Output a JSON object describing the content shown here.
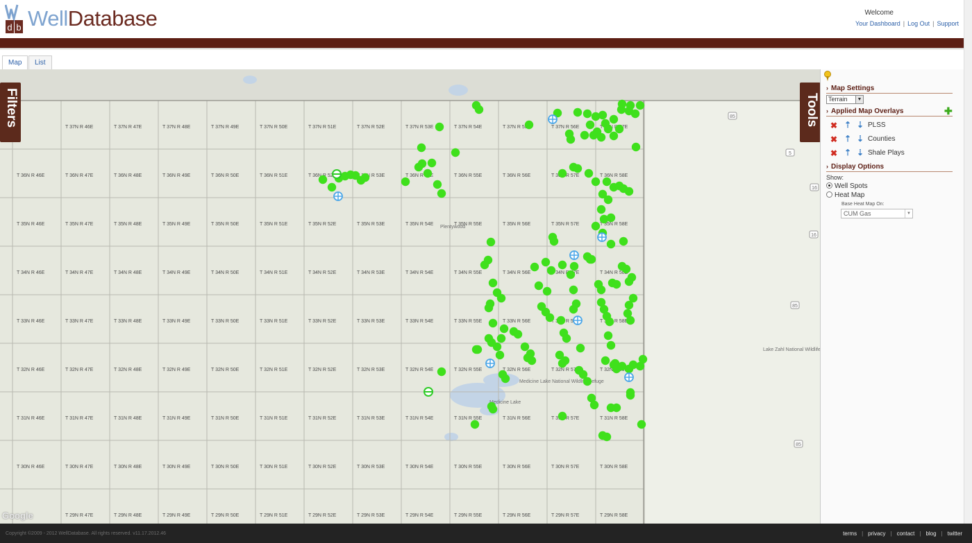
{
  "header": {
    "logo_mark": "wdb",
    "logo_well": "Well",
    "logo_database": "Database",
    "welcome": "Welcome",
    "links": [
      "Your Dashboard",
      "Log Out",
      "Support"
    ]
  },
  "tabs": [
    {
      "label": "Map",
      "active": true
    },
    {
      "label": "List",
      "active": false
    }
  ],
  "side_tabs": {
    "filters": "Filters",
    "tools": "Tools"
  },
  "map": {
    "township_rows": [
      {
        "row": "37N",
        "labels": [
          "T 37N R 46E",
          "T 37N R 47E",
          "T 37N R 48E",
          "T 37N R 49E",
          "T 37N R 50E",
          "T 37N R 51E",
          "T 37N R 52E",
          "T 37N R 53E",
          "T 37N R 54E",
          "T 37N R 55E",
          "T 37N R 56E",
          "T 37N R 57E"
        ]
      },
      {
        "row": "36N",
        "labels": [
          "T 36N R 46E",
          "T 36N R 47E",
          "T 36N R 48E",
          "T 36N R 49E",
          "T 36N R 50E",
          "T 36N R 51E",
          "T 36N R 52E",
          "T 36N R 53E",
          "T 36N R 54E",
          "T 36N R 55E",
          "T 36N R 56E",
          "T 36N R 57E",
          "T 36N R 58E"
        ]
      },
      {
        "row": "35N",
        "labels": [
          "T 35N R 46E",
          "T 35N R 47E",
          "T 35N R 48E",
          "T 35N R 49E",
          "T 35N R 50E",
          "T 35N R 51E",
          "T 35N R 52E",
          "T 35N R 53E",
          "T 35N R 54E",
          "T 35N R 55E",
          "T 35N R 56E",
          "T 35N R 57E",
          "T 35N R 58E"
        ]
      },
      {
        "row": "34N",
        "labels": [
          "T 34N R 46E",
          "T 34N R 47E",
          "T 34N R 48E",
          "T 34N R 49E",
          "T 34N R 50E",
          "T 34N R 51E",
          "T 34N R 52E",
          "T 34N R 53E",
          "T 34N R 54E",
          "T 34N R 55E",
          "T 34N R 56E",
          "T 34N R 57E",
          "T 34N R 58E"
        ]
      },
      {
        "row": "33N",
        "labels": [
          "T 33N R 46E",
          "T 33N R 47E",
          "T 33N R 48E",
          "T 33N R 49E",
          "T 33N R 50E",
          "T 33N R 51E",
          "T 33N R 52E",
          "T 33N R 53E",
          "T 33N R 54E",
          "T 33N R 55E",
          "T 33N R 56E",
          "T 33N R 57E",
          "T 33N R 58E"
        ]
      },
      {
        "row": "32N",
        "labels": [
          "T 32N R 46E",
          "T 32N R 47E",
          "T 32N R 48E",
          "T 32N R 49E",
          "T 32N R 50E",
          "T 32N R 51E",
          "T 32N R 52E",
          "T 32N R 53E",
          "T 32N R 54E",
          "T 32N R 55E",
          "T 32N R 56E",
          "T 32N R 57E",
          "T 32N R 58E"
        ]
      },
      {
        "row": "31N",
        "labels": [
          "T 31N R 46E",
          "T 31N R 47E",
          "T 31N R 48E",
          "T 31N R 49E",
          "T 31N R 50E",
          "T 31N R 51E",
          "T 31N R 52E",
          "T 31N R 53E",
          "T 31N R 54E",
          "T 31N R 55E",
          "T 31N R 56E",
          "T 31N R 57E",
          "T 31N R 58E"
        ]
      },
      {
        "row": "30N",
        "labels": [
          "T 30N R 46E",
          "T 30N R 47E",
          "T 30N R 48E",
          "T 30N R 49E",
          "T 30N R 50E",
          "T 30N R 51E",
          "T 30N R 52E",
          "T 30N R 53E",
          "T 30N R 54E",
          "T 30N R 55E",
          "T 30N R 56E",
          "T 30N R 57E",
          "T 30N R 58E"
        ]
      },
      {
        "row": "29N",
        "labels": [
          "T 29N R 47E",
          "T 29N R 48E",
          "T 29N R 49E",
          "T 29N R 50E",
          "T 29N R 51E",
          "T 29N R 52E",
          "T 29N R 53E",
          "T 29N R 54E",
          "T 29N R 55E",
          "T 29N R 56E",
          "T 29N R 57E",
          "T 29N R 58E"
        ]
      }
    ],
    "places": [
      "Plentywood",
      "Medicine Lake National Wildlife Refuge",
      "Medicine Lake",
      "Lake Zahl National Wildlife Refuge"
    ],
    "highway_shields": [
      "85",
      "5",
      "16",
      "16",
      "85",
      "85"
    ],
    "google_label": "Google",
    "well_spot_color": "#3fe01c",
    "well_symbol_color": "#4aa6e8"
  },
  "tools": {
    "map_settings": "Map Settings",
    "map_type": "Terrain",
    "applied_overlays": "Applied Map Overlays",
    "overlays": [
      "PLSS",
      "Counties",
      "Shale Plays"
    ],
    "display_options": "Display Options",
    "show_label": "Show:",
    "display_modes": [
      {
        "label": "Well Spots",
        "selected": true
      },
      {
        "label": "Heat Map",
        "selected": false
      }
    ],
    "heat_label": "Base Heat Map On:",
    "heat_base": "CUM Gas"
  },
  "footer": {
    "copyright": "Copyright ©2009 - 2012 WellDatabase. All rights reserved. v11.17.2012.46",
    "links": [
      "terms",
      "privacy",
      "contact",
      "blog",
      "twitter"
    ]
  }
}
